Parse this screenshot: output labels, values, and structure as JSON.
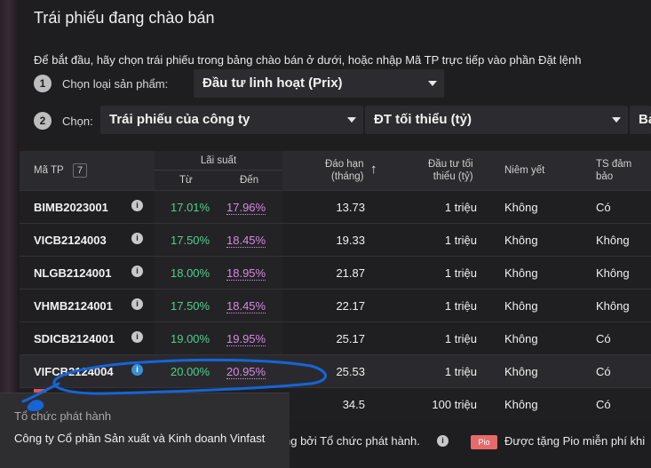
{
  "title": "Trái phiếu đang chào bán",
  "instruction": "Để bắt đầu, hãy chọn trái phiếu trong bảng chào bán ở dưới, hoặc nhập Mã TP trực tiếp vào phần Đặt lệnh",
  "steps": [
    {
      "num": "1",
      "label": "Chọn loại sản phẩm:",
      "select": "Đầu tư linh hoạt (Prix)"
    },
    {
      "num": "2",
      "label": "Chọn:",
      "select": "Trái phiếu của công ty",
      "select2": "ĐT tối thiểu (tỷ)",
      "select3": "Bả"
    }
  ],
  "table": {
    "headers": {
      "code": "Mã TP",
      "count": "7",
      "rate": "Lãi suất",
      "from": "Từ",
      "to": "Đến",
      "term_line1": "Đáo hạn",
      "term_line2": "(tháng)",
      "min_line1": "Đầu tư tối",
      "min_line2": "thiểu (tỷ)",
      "listed": "Niêm yết",
      "sec_line1": "TS đảm",
      "sec_line2": "bảo"
    },
    "rows": [
      {
        "code": "BIMB2023001",
        "from": "17.01%",
        "to": "17.96%",
        "term": "13.73",
        "min": "1 triệu",
        "listed": "Không",
        "sec": "Có"
      },
      {
        "code": "VICB2124003",
        "from": "17.50%",
        "to": "18.45%",
        "term": "19.33",
        "min": "1 triệu",
        "listed": "Không",
        "sec": "Không"
      },
      {
        "code": "NLGB2124001",
        "from": "18.00%",
        "to": "18.95%",
        "term": "21.87",
        "min": "1 triệu",
        "listed": "Không",
        "sec": "Không"
      },
      {
        "code": "VHMB2124001",
        "from": "17.50%",
        "to": "18.45%",
        "term": "22.17",
        "min": "1 triệu",
        "listed": "Không",
        "sec": "Không"
      },
      {
        "code": "SDICB2124001",
        "from": "19.00%",
        "to": "19.95%",
        "term": "25.17",
        "min": "1 triệu",
        "listed": "Không",
        "sec": "Có"
      },
      {
        "code": "VIFCB2124004",
        "from": "20.00%",
        "to": "20.95%",
        "term": "25.53",
        "min": "1 triệu",
        "listed": "Không",
        "sec": "Có"
      },
      {
        "code": "",
        "from": "",
        "to": "",
        "term": "34.5",
        "min": "100 triệu",
        "listed": "Không",
        "sec": "Có"
      }
    ]
  },
  "footer": {
    "issuer_note": "ng bởi Tổ chức phát hành.",
    "pio_badge": "Pio",
    "pio_text": "Được tặng Pio miễn phí khi"
  },
  "tooltip": {
    "title": "Tổ chức phát hành",
    "body": "Công ty Cổ phần Sản xuất và Kinh doanh Vinfast"
  },
  "colors": {
    "rate_from": "#4fd08a",
    "rate_to": "#d68ae0",
    "annotation": "#1565d8"
  }
}
